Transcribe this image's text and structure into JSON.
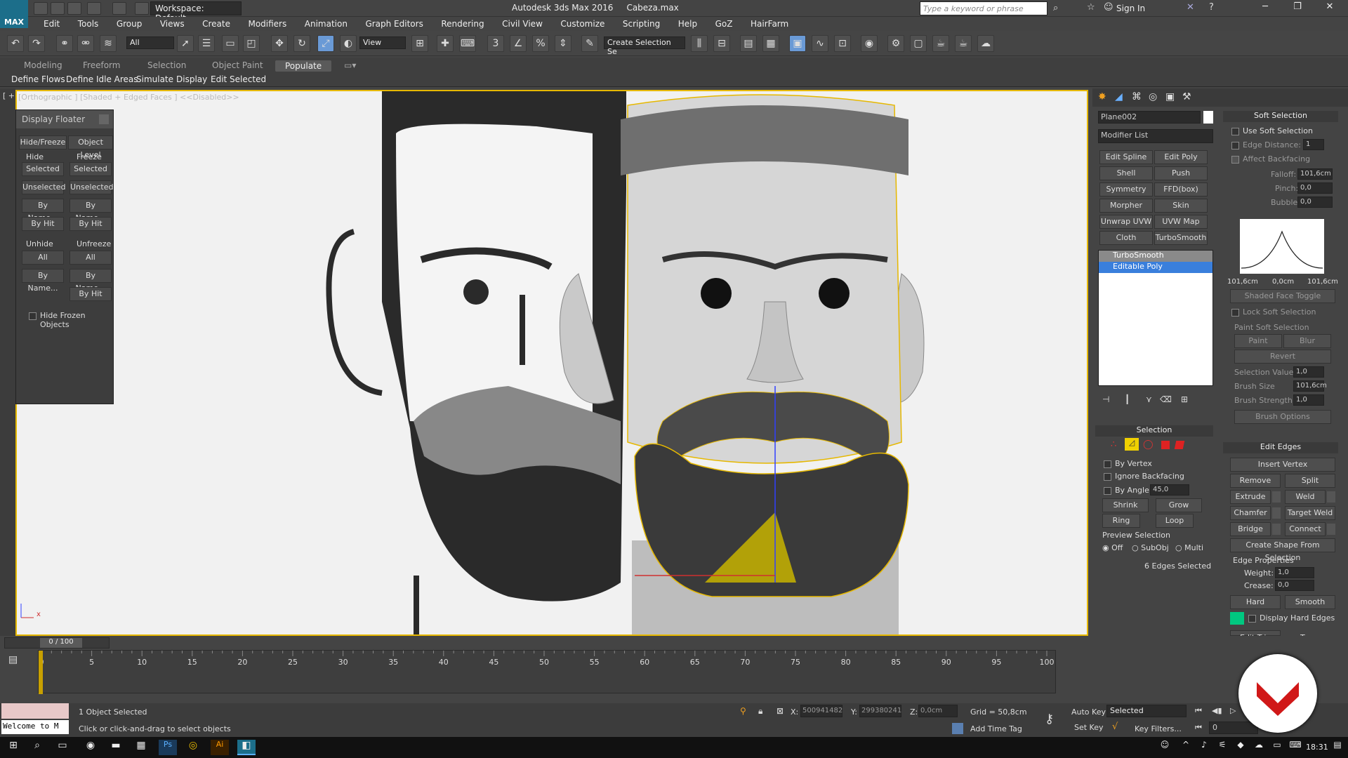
{
  "app": {
    "logo_text": "MAX",
    "title": "Autodesk 3ds Max 2016",
    "file": "Cabeza.max",
    "workspace": "Workspace: Default",
    "search_placeholder": "Type a keyword or phrase",
    "sign_in": "Sign In"
  },
  "menu": [
    "Edit",
    "Tools",
    "Group",
    "Views",
    "Create",
    "Modifiers",
    "Animation",
    "Graph Editors",
    "Rendering",
    "Civil View",
    "Customize",
    "Scripting",
    "Help",
    "GoZ",
    "HairFarm"
  ],
  "toolbar": {
    "filter": "All",
    "refcoord": "View",
    "selection_set": "Create Selection Se"
  },
  "ribbon": {
    "tabs": [
      "Modeling",
      "Freeform",
      "Selection",
      "Object Paint",
      "Populate"
    ],
    "active_tab": "Populate",
    "sub": [
      "Define Flows",
      "Define Idle Areas",
      "Simulate",
      "Display",
      "Edit Selected"
    ]
  },
  "viewport": {
    "label": "[ + ]",
    "label2": "[Orthographic ] [Shaded + Edged Faces ]  <<Disabled>>",
    "axis_x": "x"
  },
  "floater": {
    "title": "Display Floater",
    "tabs": [
      "Hide/Freeze",
      "Object Level"
    ],
    "hide": "Hide",
    "freeze": "Freeze",
    "hide_buttons": [
      "Selected",
      "Unselected",
      "By Name...",
      "By Hit"
    ],
    "freeze_buttons": [
      "Selected",
      "Unselected",
      "By Name...",
      "By Hit"
    ],
    "unhide": "Unhide",
    "unfreeze": "Unfreeze",
    "unhide_buttons": [
      "All",
      "By Name..."
    ],
    "unfreeze_buttons": [
      "All",
      "By Name...",
      "By Hit"
    ],
    "hide_frozen": "Hide Frozen Objects"
  },
  "command": {
    "object_name": "Plane002",
    "modifier_list": "Modifier List",
    "mod_buttons": [
      "Edit Spline",
      "Edit Poly",
      "Shell",
      "Push",
      "Symmetry",
      "FFD(box)",
      "Morpher",
      "Skin",
      "Unwrap UVW",
      "UVW Map",
      "Cloth",
      "TurboSmooth"
    ],
    "stack": [
      "TurboSmooth",
      "Editable Poly"
    ],
    "selection": {
      "title": "Selection",
      "by_vertex": "By Vertex",
      "ignore_backfacing": "Ignore Backfacing",
      "by_angle": "By Angle:",
      "angle": "45,0",
      "shrink": "Shrink",
      "grow": "Grow",
      "ring": "Ring",
      "loop": "Loop",
      "preview": "Preview Selection",
      "off": "Off",
      "subobj": "SubObj",
      "multi": "Multi",
      "status": "6 Edges Selected"
    },
    "soft": {
      "title": "Soft Selection",
      "use": "Use Soft Selection",
      "edge_distance": "Edge Distance:",
      "edge_distance_val": "1",
      "affect_backfacing": "Affect Backfacing",
      "falloff": "Falloff:",
      "falloff_val": "101,6cm",
      "pinch": "Pinch:",
      "pinch_val": "0,0",
      "bubble": "Bubble:",
      "bubble_val": "0,0",
      "curve_left": "101,6cm",
      "curve_mid": "0,0cm",
      "curve_right": "101,6cm",
      "shaded_face_toggle": "Shaded Face Toggle",
      "lock": "Lock Soft Selection",
      "paint_group": "Paint Soft Selection",
      "paint": "Paint",
      "blur": "Blur",
      "revert": "Revert",
      "selection_value": "Selection Value",
      "selection_value_val": "1,0",
      "brush_size": "Brush Size",
      "brush_size_val": "101,6cm",
      "brush_strength": "Brush Strength",
      "brush_strength_val": "1,0",
      "brush_options": "Brush Options"
    },
    "edges": {
      "title": "Edit Edges",
      "insert_vertex": "Insert Vertex",
      "remove": "Remove",
      "split": "Split",
      "extrude": "Extrude",
      "weld": "Weld",
      "chamfer": "Chamfer",
      "target_weld": "Target Weld",
      "bridge": "Bridge",
      "connect": "Connect",
      "create_shape": "Create Shape From Selection",
      "edge_props": "Edge Properties",
      "weight": "Weight:",
      "weight_val": "1,0",
      "crease": "Crease:",
      "crease_val": "0,0",
      "hard": "Hard",
      "smooth": "Smooth",
      "display_hard": "Display Hard Edges",
      "edit_tri": "Edit Tri.",
      "turn": "Turn"
    },
    "accent": "#00c880"
  },
  "timeline": {
    "frame": "0 / 100",
    "ticks": [
      "0",
      "5",
      "10",
      "15",
      "20",
      "25",
      "30",
      "35",
      "40",
      "45",
      "50",
      "55",
      "60",
      "65",
      "70",
      "75",
      "80",
      "85",
      "90",
      "95",
      "100"
    ]
  },
  "status": {
    "maxscript": "Welcome to M",
    "selected": "1 Object Selected",
    "prompt": "Click or click-and-drag to select objects",
    "x_label": "X:",
    "x": "500941482",
    "y_label": "Y:",
    "y": "299380241",
    "z_label": "Z:",
    "z": "0,0cm",
    "grid": "Grid = 50,8cm",
    "add_time_tag": "Add Time Tag",
    "auto_key": "Auto Key",
    "set_key": "Set Key",
    "key_mode": "Selected",
    "key_filters": "Key Filters...",
    "frame_field": "0"
  },
  "taskbar": {
    "time": "18:31"
  }
}
